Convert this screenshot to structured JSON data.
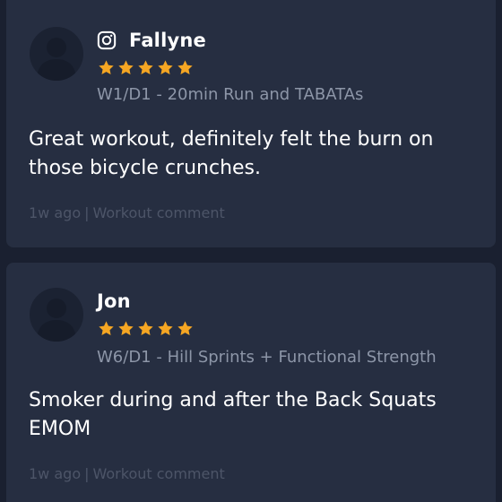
{
  "colors": {
    "background": "#1a2030",
    "card": "#262e41",
    "star": "#f5a623",
    "secondary_text": "#8d96a8",
    "muted_text": "#4d5568"
  },
  "comments": [
    {
      "author": "Fallyne",
      "source_icon": "instagram-icon",
      "rating": 5,
      "workout": "W1/D1 - 20min Run and TABATAs",
      "text": "Great workout, definitely felt the burn on those bicycle crunches.",
      "time": "1w ago",
      "separator": "|",
      "type": "Workout comment"
    },
    {
      "author": "Jon",
      "rating": 5,
      "workout": "W6/D1 - Hill Sprints + Functional Strength",
      "text": "Smoker during and after the Back Squats EMOM",
      "time": "1w ago",
      "separator": "|",
      "type": "Workout comment"
    }
  ]
}
